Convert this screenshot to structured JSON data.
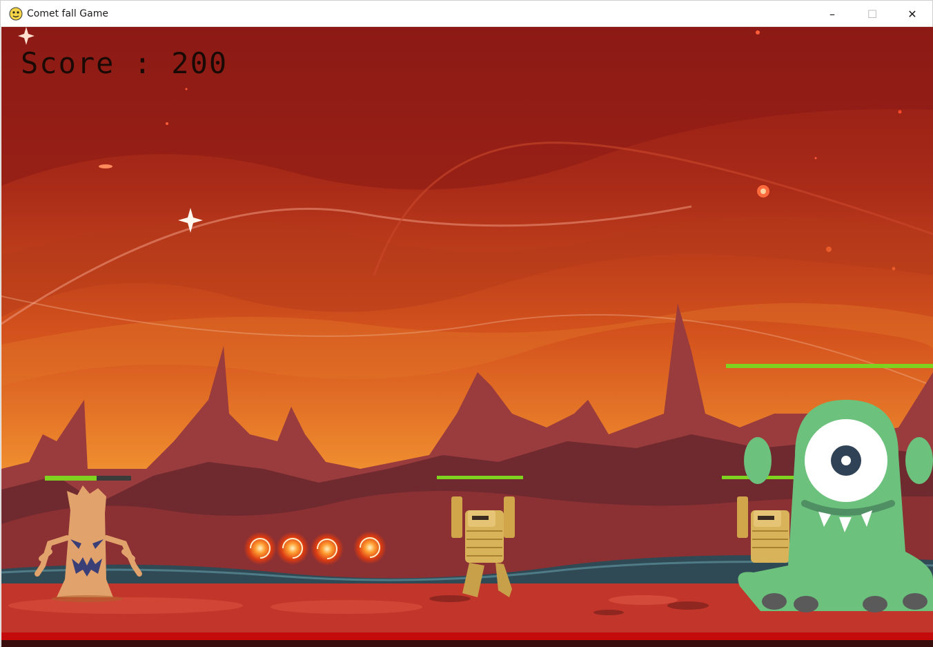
{
  "window": {
    "title": "Comet fall Game",
    "app_icon": "python-icon",
    "controls": {
      "minimize": "–",
      "maximize": "☐",
      "close": "✕"
    }
  },
  "hud": {
    "score_label": "Score",
    "score_separator": ":",
    "score_value": "200",
    "score_text": "Score : 200"
  },
  "colors": {
    "health_fill": "#7ed321",
    "health_back": "#3b3b3b",
    "ground_bar": "#c40a0a"
  },
  "entities": [
    {
      "name": "player-tree-monster",
      "health_fraction": 0.6
    },
    {
      "name": "mummy-monster-1",
      "health_fraction": 1.0
    },
    {
      "name": "mummy-monster-2",
      "health_fraction": 1.0
    },
    {
      "name": "alien-boss-monster",
      "health_fraction": 1.0
    }
  ],
  "projectiles": {
    "count": 4,
    "type": "vortex-projectile"
  }
}
